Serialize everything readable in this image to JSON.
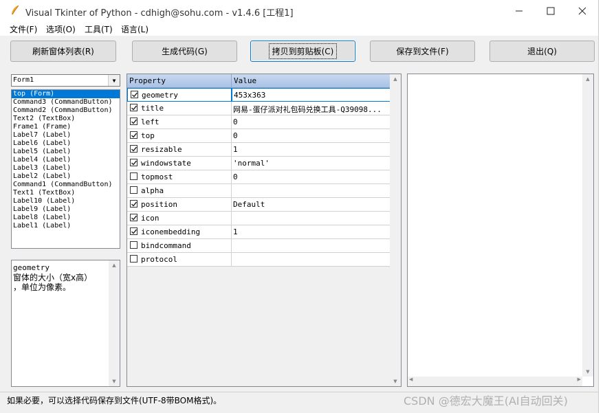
{
  "window": {
    "title": "Visual Tkinter of Python - cdhigh@sohu.com - v1.4.6 [工程1]",
    "minimize_icon": "minimize-icon",
    "maximize_icon": "maximize-icon",
    "close_icon": "close-icon"
  },
  "menu": [
    "文件(F)",
    "选项(O)",
    "工具(T)",
    "语言(L)"
  ],
  "toolbar": {
    "refresh": "刷新窗体列表(R)",
    "generate": "生成代码(G)",
    "copy": "拷贝到剪贴板(C)",
    "save": "保存到文件(F)",
    "exit": "退出(Q)"
  },
  "form_combo": {
    "value": "Form1"
  },
  "widget_list": [
    "top (Form)",
    "Command3 (CommandButton)",
    "Command2 (CommandButton)",
    "Text2 (TextBox)",
    "Frame1 (Frame)",
    "Label7 (Label)",
    "Label6 (Label)",
    "Label5 (Label)",
    "Label4 (Label)",
    "Label3 (Label)",
    "Label2 (Label)",
    "Command1 (CommandButton)",
    "Text1 (TextBox)",
    "Label10 (Label)",
    "Label9 (Label)",
    "Label8 (Label)",
    "Label1 (Label)"
  ],
  "description": {
    "name": "geometry",
    "text1": "窗体的大小（宽x高）",
    "text2": "，单位为像素。"
  },
  "grid": {
    "col_property": "Property",
    "col_value": "Value",
    "rows": [
      {
        "name": "geometry",
        "value": "453x363",
        "checked": true
      },
      {
        "name": "title",
        "value": "网易-蛋仔派对礼包码兑换工具-Q39098...",
        "checked": true
      },
      {
        "name": "left",
        "value": "0",
        "checked": true
      },
      {
        "name": "top",
        "value": "0",
        "checked": true
      },
      {
        "name": "resizable",
        "value": "1",
        "checked": true
      },
      {
        "name": "windowstate",
        "value": "'normal'",
        "checked": true
      },
      {
        "name": "topmost",
        "value": "0",
        "checked": false
      },
      {
        "name": "alpha",
        "value": "",
        "checked": false
      },
      {
        "name": "position",
        "value": "Default",
        "checked": true
      },
      {
        "name": "icon",
        "value": "",
        "checked": true
      },
      {
        "name": "iconembedding",
        "value": "1",
        "checked": true
      },
      {
        "name": "bindcommand",
        "value": "",
        "checked": false
      },
      {
        "name": "protocol",
        "value": "",
        "checked": false
      }
    ]
  },
  "status": "如果必要，可以选择代码保存到文件(UTF-8带BOM格式)。",
  "watermark": "CSDN @德宏大魔王(AI自动回关)",
  "colors": {
    "selection": "#0078d7",
    "grid_header": "#b9cdea"
  }
}
